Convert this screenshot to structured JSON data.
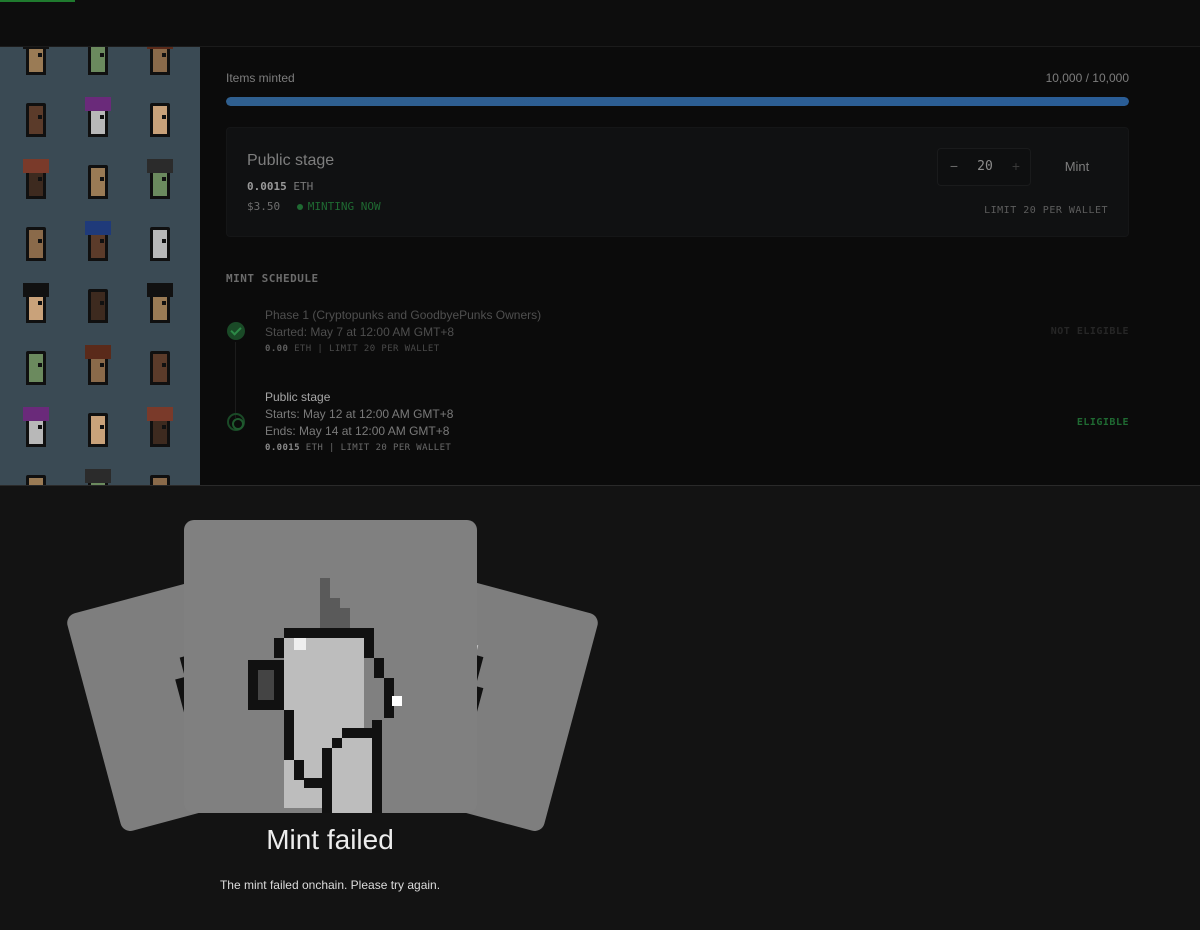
{
  "progress": {
    "label": "Items minted",
    "count": "10,000 / 10,000",
    "fraction": 1.0
  },
  "stage_card": {
    "title": "Public stage",
    "price_value": "0.0015",
    "price_unit": "ETH",
    "usd": "$3.50",
    "status": "MINTING NOW",
    "quantity": "20",
    "minus": "−",
    "plus": "+",
    "mint_label": "Mint",
    "limit": "LIMIT 20 PER WALLET"
  },
  "schedule": {
    "title": "MINT SCHEDULE",
    "phases": [
      {
        "title": "Phase 1 (Cryptopunks and GoodbyePunks Owners)",
        "line1": "Started: May 7 at 12:00 AM GMT+8",
        "price_value": "0.00",
        "meta_rest": "ETH | LIMIT 20 PER WALLET",
        "eligibility": "NOT ELIGIBLE"
      },
      {
        "title": "Public stage",
        "line1": "Starts: May 12 at 12:00 AM GMT+8",
        "line2": "Ends: May 14 at 12:00 AM GMT+8",
        "price_value": "0.0015",
        "meta_rest": "ETH | LIMIT 20 PER WALLET",
        "eligibility": "ELIGIBLE"
      }
    ]
  },
  "modal": {
    "title": "Mint failed",
    "message": "The mint failed onchain. Please try again."
  },
  "colors": {
    "accent_green": "#2d8a47",
    "progress_blue": "#2a5d96",
    "gallery_bg": "#3a4a54"
  }
}
